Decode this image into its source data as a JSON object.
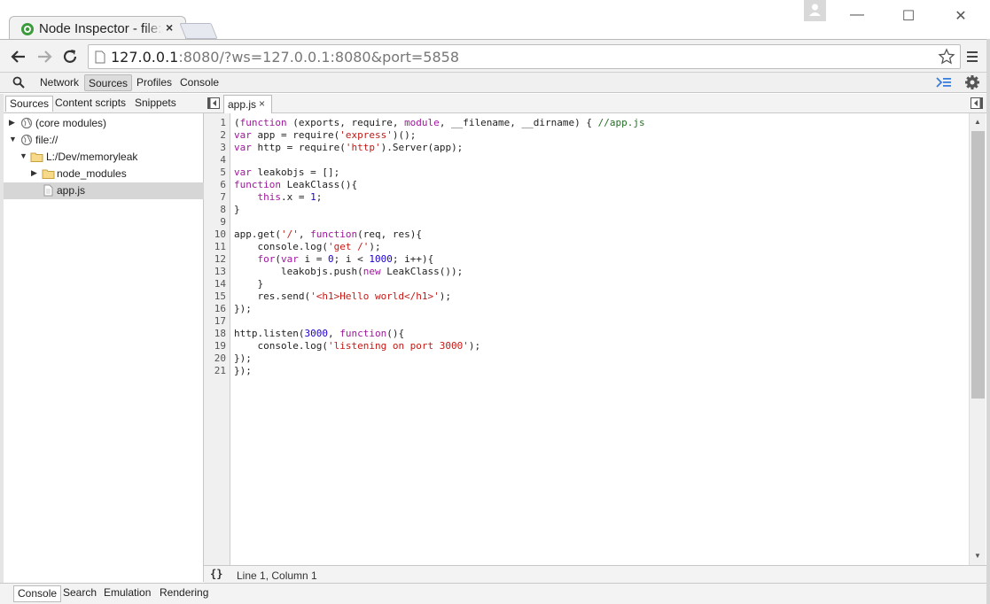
{
  "browser": {
    "tab_title": "Node Inspector - file:///L:/Dev/memoryleak/app.js",
    "tab_close": "×",
    "url_host": "127.0.0.1",
    "url_rest": ":8080/?ws=127.0.0.1:8080&port=5858",
    "window_controls": {
      "minimize": "—",
      "maximize": "☐",
      "close": "✕"
    }
  },
  "devtools": {
    "top_tabs": [
      "Network",
      "Sources",
      "Profiles",
      "Console"
    ],
    "active_top_tab": "Sources",
    "navigator_tabs": [
      "Sources",
      "Content scripts",
      "Snippets"
    ],
    "tree": [
      {
        "label": "(core modules)",
        "depth": 0,
        "expanded": false,
        "icon": "globe-icon"
      },
      {
        "label": "file://",
        "depth": 0,
        "expanded": true,
        "icon": "globe-icon"
      },
      {
        "label": "L:/Dev/memoryleak",
        "depth": 1,
        "expanded": true,
        "icon": "folder-icon"
      },
      {
        "label": "node_modules",
        "depth": 2,
        "expanded": false,
        "icon": "folder-icon"
      },
      {
        "label": "app.js",
        "depth": 2,
        "selected": true,
        "icon": "file-icon"
      }
    ],
    "open_file": "app.js",
    "file_tab_close": "×",
    "status": {
      "pretty_print": "{}",
      "cursor": "Line 1, Column 1"
    },
    "drawer_tabs": [
      "Console",
      "Search",
      "Emulation",
      "Rendering"
    ],
    "code_lines": [
      "(function (exports, require, module, __filename, __dirname) { //app.js",
      "var app = require('express')();",
      "var http = require('http').Server(app);",
      "",
      "var leakobjs = [];",
      "function LeakClass(){",
      "    this.x = 1;",
      "}",
      "",
      "app.get('/', function(req, res){",
      "    console.log('get /');",
      "    for(var i = 0; i < 1000; i++){",
      "        leakobjs.push(new LeakClass());",
      "    }",
      "    res.send('<h1>Hello world</h1>');",
      "});",
      "",
      "http.listen(3000, function(){",
      "    console.log('listening on port 3000');",
      "});",
      "});"
    ],
    "line_numbers": [
      "1",
      "2",
      "3",
      "4",
      "5",
      "6",
      "7",
      "8",
      "9",
      "10",
      "11",
      "12",
      "13",
      "14",
      "15",
      "16",
      "17",
      "18",
      "19",
      "20",
      "21"
    ]
  },
  "colors": {
    "keyword": "#a1169e",
    "string": "#c41a16",
    "number": "#1c00cf",
    "comment": "#236e25"
  }
}
